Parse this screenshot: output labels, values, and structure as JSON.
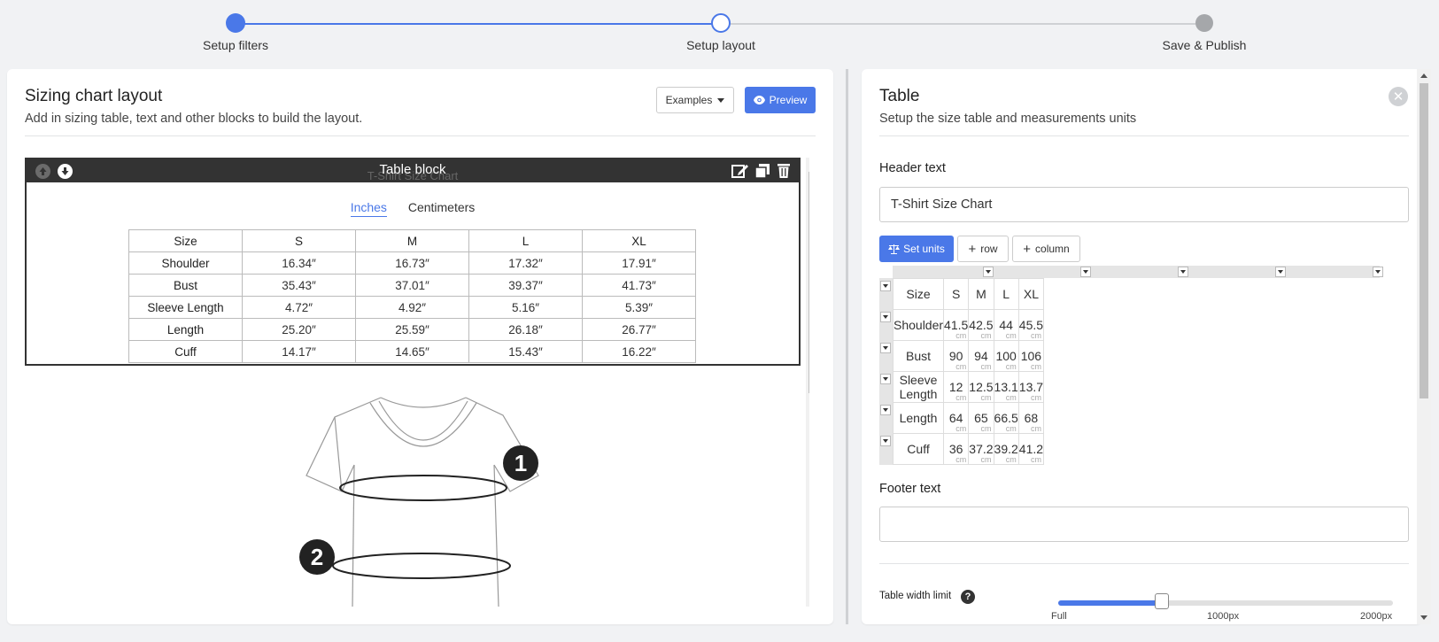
{
  "stepper": {
    "steps": [
      {
        "label": "Setup filters",
        "state": "done"
      },
      {
        "label": "Setup layout",
        "state": "current"
      },
      {
        "label": "Save & Publish",
        "state": "todo"
      }
    ]
  },
  "left": {
    "title": "Sizing chart layout",
    "subtitle": "Add in sizing table, text and other blocks to build the layout.",
    "examples_label": "Examples",
    "preview_label": "Preview",
    "block": {
      "title": "Table block",
      "ghost_title": "T-Shirt Size Chart",
      "unit_tabs": [
        "Inches",
        "Centimeters"
      ],
      "active_unit": "Inches",
      "header": [
        "Size",
        "S",
        "M",
        "L",
        "XL"
      ],
      "rows": [
        [
          "Shoulder",
          "16.34″",
          "16.73″",
          "17.32″",
          "17.91″"
        ],
        [
          "Bust",
          "35.43″",
          "37.01″",
          "39.37″",
          "41.73″"
        ],
        [
          "Sleeve Length",
          "4.72″",
          "4.92″",
          "5.16″",
          "5.39″"
        ],
        [
          "Length",
          "25.20″",
          "25.59″",
          "26.18″",
          "26.77″"
        ],
        [
          "Cuff",
          "14.17″",
          "14.65″",
          "15.43″",
          "16.22″"
        ]
      ]
    },
    "diagram": {
      "marker1": "1",
      "marker2": "2"
    }
  },
  "right": {
    "title": "Table",
    "subtitle": "Setup the size table and measurements units",
    "header_label": "Header text",
    "header_value": "T-Shirt Size Chart",
    "set_units_label": "Set units",
    "row_label": "row",
    "column_label": "column",
    "unit_suffix": "cm",
    "header": [
      "Size",
      "S",
      "M",
      "L",
      "XL"
    ],
    "rows": [
      [
        "Shoulder",
        "41.5",
        "42.5",
        "44",
        "45.5"
      ],
      [
        "Bust",
        "90",
        "94",
        "100",
        "106"
      ],
      [
        "Sleeve Length",
        "12",
        "12.5",
        "13.1",
        "13.7"
      ],
      [
        "Length",
        "64",
        "65",
        "66.5",
        "68"
      ],
      [
        "Cuff",
        "36",
        "37.2",
        "39.2",
        "41.2"
      ]
    ],
    "footer_label": "Footer text",
    "footer_value": "",
    "width_limit_label": "Table width limit",
    "help_glyph": "?",
    "slider_ticks": [
      "Full",
      "1000px",
      "2000px"
    ],
    "slider_value_fraction": 0.31
  },
  "colors": {
    "accent": "#4a78e8",
    "dark_bar": "#333333"
  }
}
